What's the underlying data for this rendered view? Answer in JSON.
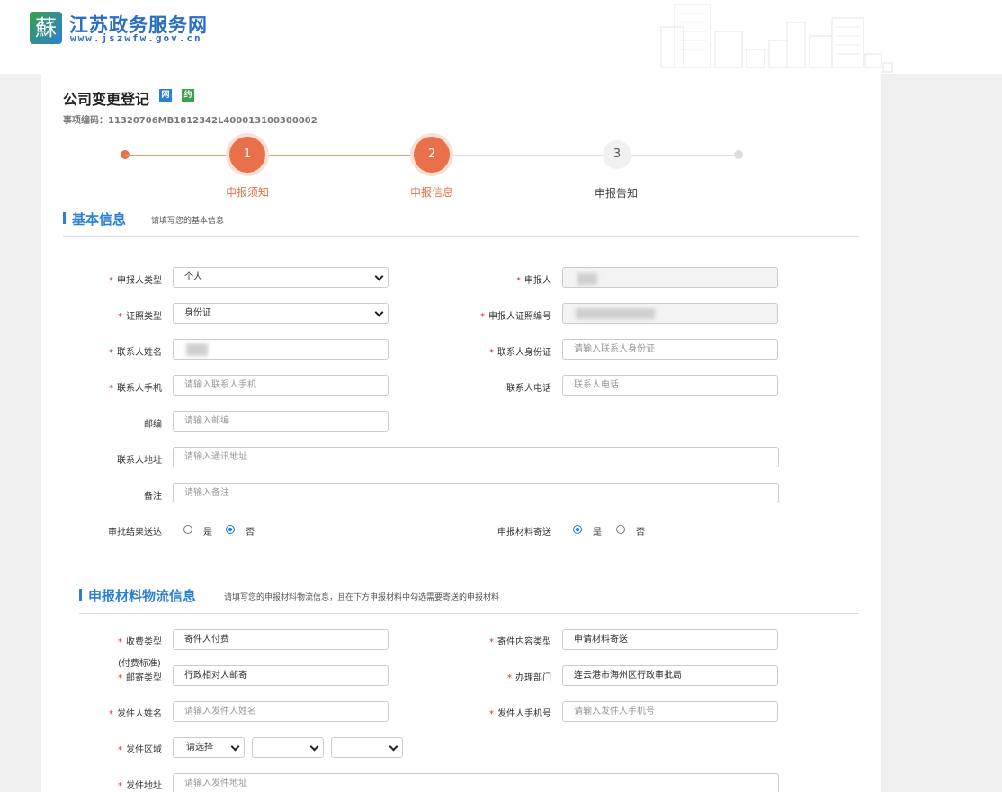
{
  "header": {
    "logo_char": "蘇",
    "site_name": "江苏政务服务网",
    "site_url": "www.jszwfw.gov.cn"
  },
  "page": {
    "title": "公司变更登记",
    "badge_online": "网",
    "badge_appointment": "约",
    "item_code": "事项编码：11320706MB1812342L400013100300002"
  },
  "steps": [
    {
      "num": "1",
      "label": "申报须知",
      "state": "done"
    },
    {
      "num": "2",
      "label": "申报信息",
      "state": "current"
    },
    {
      "num": "3",
      "label": "申报告知",
      "state": "todo"
    }
  ],
  "basic": {
    "title": "基本信息",
    "hint": "请填写您的基本信息",
    "fields": {
      "applicant_type": {
        "label": "申报人类型",
        "value": "个人"
      },
      "applicant": {
        "label": "申报人",
        "value": ""
      },
      "cert_type": {
        "label": "证照类型",
        "value": "身份证"
      },
      "cert_no": {
        "label": "申报人证照编号",
        "value": ""
      },
      "contact_name": {
        "label": "联系人姓名",
        "value": ""
      },
      "contact_id": {
        "label": "联系人身份证",
        "placeholder": "请输入联系人身份证"
      },
      "contact_mobile": {
        "label": "联系人手机",
        "placeholder": "请输入联系人手机"
      },
      "contact_phone": {
        "label": "联系人电话",
        "placeholder": "联系人电话"
      },
      "postcode": {
        "label": "邮编",
        "placeholder": "请输入邮编"
      },
      "address": {
        "label": "联系人地址",
        "placeholder": "请输入通讯地址"
      },
      "remark": {
        "label": "备注",
        "placeholder": "请输入备注"
      },
      "result_delivery": {
        "label": "审批结果送达",
        "yes": "是",
        "no": "否",
        "selected": "否"
      },
      "material_mailing": {
        "label": "申报材料寄送",
        "yes": "是",
        "no": "否",
        "selected": "是"
      }
    }
  },
  "logistics": {
    "title": "申报材料物流信息",
    "hint": "请填写您的申报材料物流信息，且在下方申报材料中勾选需要寄送的申报材料",
    "fields": {
      "fee_type": {
        "label": "收费类型",
        "value": "寄件人付费"
      },
      "fee_standard": {
        "label": "(付费标准)"
      },
      "content_type": {
        "label": "寄件内容类型",
        "value": "申请材料寄送"
      },
      "mail_type": {
        "label": "邮寄类型",
        "value": "行政相对人邮寄"
      },
      "dept": {
        "label": "办理部门",
        "value": "连云港市海州区行政审批局"
      },
      "sender_name": {
        "label": "发件人姓名",
        "placeholder": "请输入发件人姓名"
      },
      "sender_mobile": {
        "label": "发件人手机号",
        "placeholder": "请输入发件人手机号"
      },
      "sender_area": {
        "label": "发件区域",
        "province": "请选择",
        "city": "",
        "district": ""
      },
      "sender_address": {
        "label": "发件地址",
        "placeholder": "请输入发件地址"
      }
    }
  },
  "colors": {
    "accent": "#2c7fd4",
    "step": "#e8704a",
    "required": "#e0302c"
  }
}
